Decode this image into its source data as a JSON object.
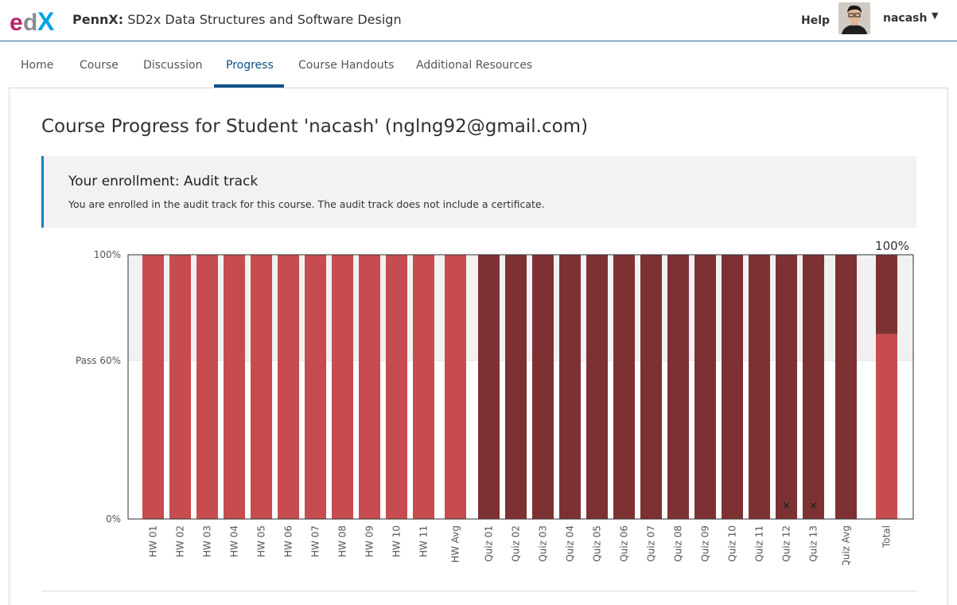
{
  "header": {
    "logo_text": "edX",
    "org": "PennX:",
    "course": "SD2x Data Structures and Software Design",
    "help_label": "Help",
    "username": "nacash",
    "caret": "▼"
  },
  "tabs": [
    {
      "label": "Home",
      "active": false
    },
    {
      "label": "Course",
      "active": false
    },
    {
      "label": "Discussion",
      "active": false
    },
    {
      "label": "Progress",
      "active": true
    },
    {
      "label": "Course Handouts",
      "active": false
    },
    {
      "label": "Additional Resources",
      "active": false
    }
  ],
  "main": {
    "title": "Course Progress for Student 'nacash' (nglng92@gmail.com)",
    "enrollment_title": "Your enrollment: Audit track",
    "enrollment_text": "You are enrolled in the audit track for this course. The audit track does not include a certificate."
  },
  "colors": {
    "accent": "#0e5287",
    "homework_bar": "#c64c4f",
    "quiz_bar": "#7d3133",
    "passing_band": "#f1f1f1",
    "enroll_border": "#1c7fc1"
  },
  "chart_data": {
    "type": "bar",
    "ylim": [
      0,
      100
    ],
    "y_tick_labels": [
      "100%",
      "Pass 60%",
      "0%"
    ],
    "y_tick_values": [
      100,
      60,
      0
    ],
    "categories": [
      "HW 01",
      "HW 02",
      "HW 03",
      "HW 04",
      "HW 05",
      "HW 06",
      "HW 07",
      "HW 08",
      "HW 09",
      "HW 10",
      "HW 11",
      "HW Avg",
      "Quiz 01",
      "Quiz 02",
      "Quiz 03",
      "Quiz 04",
      "Quiz 05",
      "Quiz 06",
      "Quiz 07",
      "Quiz 08",
      "Quiz 09",
      "Quiz 10",
      "Quiz 11",
      "Quiz 12",
      "Quiz 13",
      "Quiz Avg",
      "Total"
    ],
    "series": [
      {
        "group": "homework",
        "values": [
          100,
          100,
          100,
          100,
          100,
          100,
          100,
          100,
          100,
          100,
          100,
          100
        ]
      },
      {
        "group": "quiz",
        "values": [
          100,
          100,
          100,
          100,
          100,
          100,
          100,
          100,
          100,
          100,
          100,
          100,
          100,
          100
        ]
      }
    ],
    "dropped_markers": [
      "Quiz 12",
      "Quiz 13"
    ],
    "dropped_marker_glyph": "×",
    "total": {
      "homework_part": 70,
      "quiz_part": 30,
      "label": "100%"
    }
  }
}
